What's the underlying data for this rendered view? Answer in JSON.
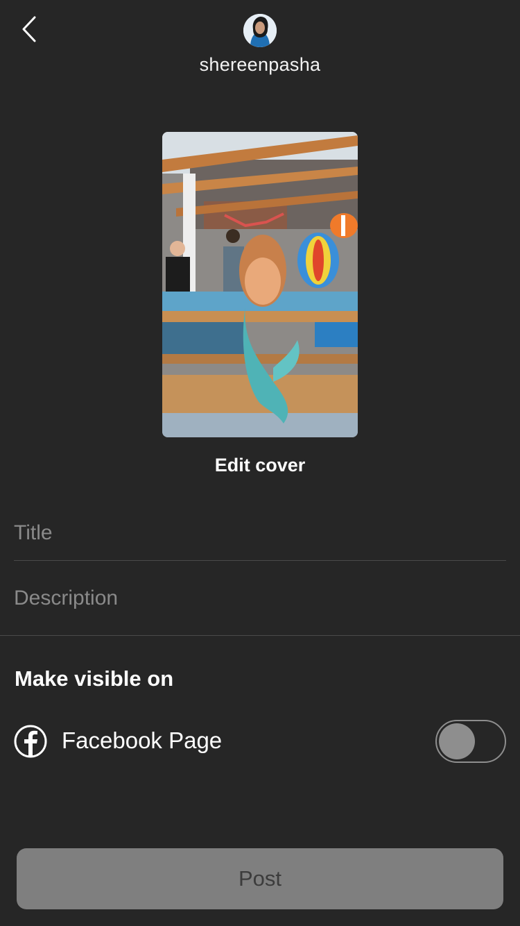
{
  "header": {
    "back_icon": "chevron-left-icon",
    "username": "shereenpasha"
  },
  "cover": {
    "edit_label": "Edit cover"
  },
  "form": {
    "title_placeholder": "Title",
    "description_placeholder": "Description"
  },
  "visibility": {
    "heading": "Make visible on",
    "options": [
      {
        "label": "Facebook Page",
        "icon": "facebook-icon",
        "enabled": false
      }
    ]
  },
  "footer": {
    "post_label": "Post"
  },
  "colors": {
    "background": "#262626",
    "divider": "#4a4a4a",
    "disabled_button": "#7f7f7f"
  }
}
